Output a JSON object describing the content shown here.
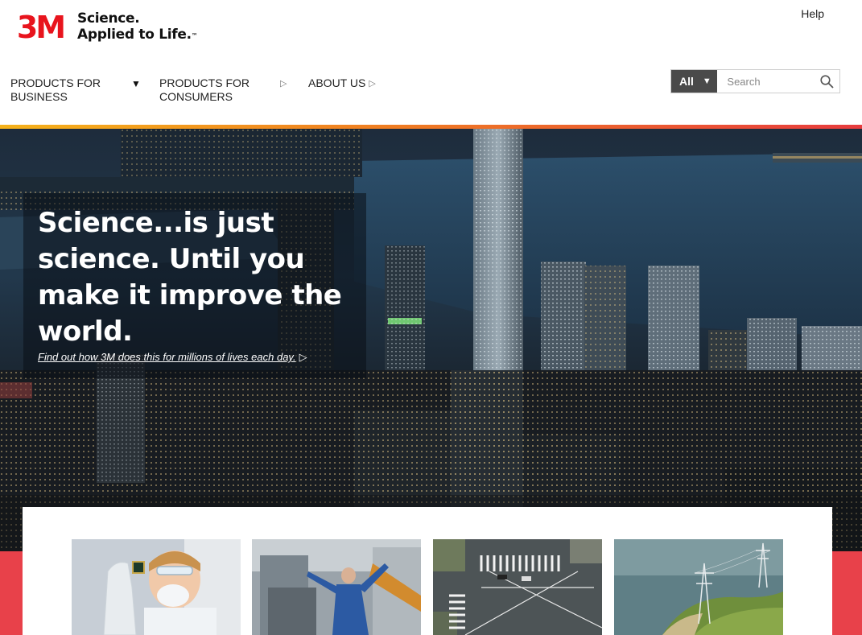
{
  "brand": {
    "logo_text": "3M",
    "tagline_line1": "Science.",
    "tagline_line2": "Applied to Life.",
    "trademark": "™",
    "color": "#e8141d"
  },
  "header": {
    "help_label": "Help"
  },
  "nav": {
    "items": [
      {
        "label": "PRODUCTS FOR BUSINESS",
        "icon": "triangle-down-icon"
      },
      {
        "label": "PRODUCTS FOR CONSUMERS",
        "icon": "triangle-right-icon"
      },
      {
        "label": "ABOUT US",
        "icon": "triangle-right-icon"
      }
    ]
  },
  "search": {
    "scope_value": "All",
    "placeholder": "Search",
    "icon": "search-icon"
  },
  "hero": {
    "title": "Science...is just science. Until you make it improve the world.",
    "link_text": "Find out how 3M does this for millions of lives each day.",
    "link_arrow": "▷"
  },
  "cards": [
    {
      "name": "scientist-holding-chip"
    },
    {
      "name": "factory-worker"
    },
    {
      "name": "city-intersection-aerial"
    },
    {
      "name": "power-lines-coast"
    }
  ],
  "colors": {
    "accent_red": "#e8414a",
    "accent_orange": "#ef7d22",
    "accent_yellow": "#f5b21b",
    "search_scope_bg": "#4a4a4a"
  }
}
